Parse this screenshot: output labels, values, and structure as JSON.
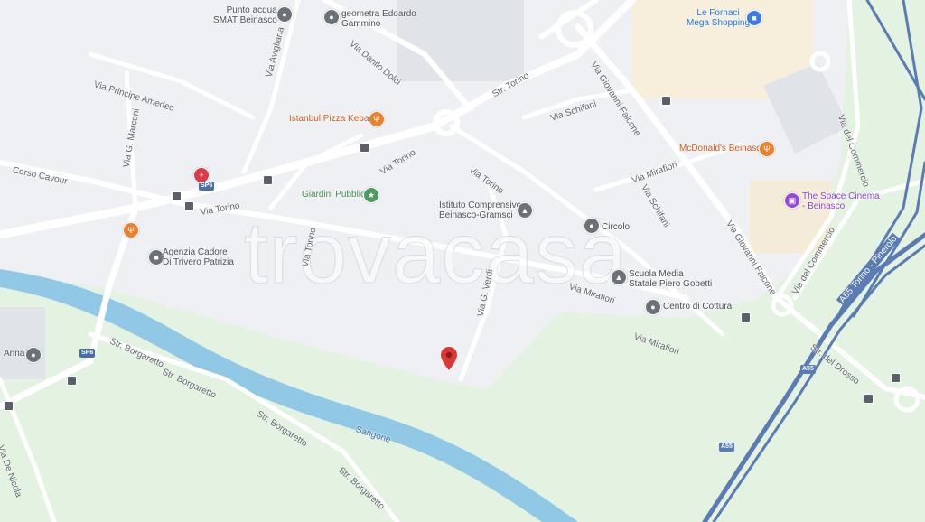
{
  "colors": {
    "green": "#e3f2e1",
    "river": "#90c8e6",
    "motorway": "#5b7bb3",
    "road": "#ffffff",
    "marker": "#d83a37"
  },
  "streets": {
    "via_principe_amedeo": "Via Principe Amedeo",
    "via_g_marconi": "Via G. Marconi",
    "corso_cavour": "Corso Cavour",
    "via_avigliana": "Via Avigliana",
    "via_danilo_dolci": "Via Danilo Dolci",
    "str_torino": "Str. Torino",
    "via_giovanni_falcone_top": "Via Giovanni Falcone",
    "via_schifani_1": "Via Schifani",
    "via_schifani_2": "Via Schifani",
    "via_mirafiori_1": "Via Mirafiori",
    "via_mirafiori_2": "Via Mirafiori",
    "via_mirafiori_3": "Via Mirafiori",
    "via_torino_1": "Via Torino",
    "via_torino_2": "Via Torino",
    "via_torino_3": "Via Torino",
    "via_torino_4": "Via Torino",
    "via_g_verdi": "Via G. Verdi",
    "via_giovanni_falcone_2": "Via Giovanni Falcone",
    "via_del_commercio_1": "Via del Commercio",
    "via_del_commercio_2": "Via del Commercio",
    "a55_label": "A55 Torino - Pinerolo",
    "str_del_drosso": "Str. del Drosso",
    "str_borgaretto_1": "Str. Borgaretto",
    "str_borgaretto_2": "Str. Borgaretto",
    "str_borgaretto_3": "Str. Borgaretto",
    "str_borgaretto_4": "Str. Borgaretto",
    "via_de_nicola": "Via De Nicola",
    "sangone": "Sangone",
    "sp6_1": "SP6",
    "sp6_2": "SP6",
    "a55_1": "A55",
    "a55_2": "A55"
  },
  "pois": {
    "punto_acqua": "Punto acqua\nSMAT Beinasco",
    "geometra": "geometra Edoardo\nGammino",
    "le_fornaci": "Le Fornaci\nMega Shopping",
    "istanbul": "Istanbul Pizza Kebap",
    "mcdonalds": "McDonald's Beinasco",
    "giardini": "Giardini Pubblici",
    "istituto": "Istituto Comprensivo\nBeinasco-Gramsci",
    "space_cinema": "The Space Cinema\n- Beinasco",
    "circolo": "Circolo",
    "agenzia": "Agenzia Cadore\nDi Trivero Patrizia",
    "scuola_media": "Scuola Media\nStatale Piero Gobetti",
    "centro_cottura": "Centro di Cottura",
    "anna": "Anna"
  },
  "watermark": "trovacasa"
}
